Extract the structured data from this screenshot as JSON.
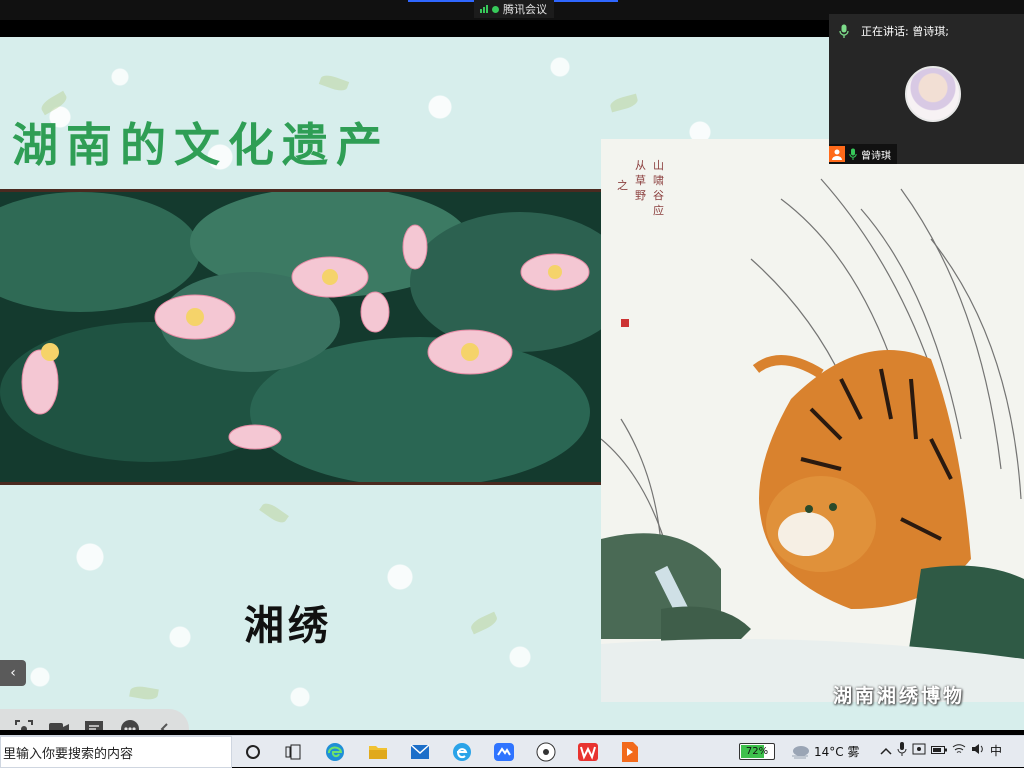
{
  "meeting": {
    "app_name": "腾讯会议",
    "speaking_label": "正在讲话: 曾诗琪;",
    "participant_name": "曾诗琪"
  },
  "slide": {
    "title": "湖南的文化遗产",
    "caption": "湘绣",
    "museum_watermark": "湖南湘绣博物"
  },
  "share_controls": {
    "icons": [
      "screenshot-icon",
      "camera-icon",
      "chat-icon",
      "more-icon",
      "collapse-icon"
    ]
  },
  "taskbar": {
    "search_placeholder": "里输入你要搜索的内容",
    "battery": "72%",
    "battery_level": 0.72,
    "weather": "14°C 雾",
    "ime": "中"
  },
  "colors": {
    "slide_bg": "#d7eeec",
    "title_green": "#2f9e55",
    "signal_green": "#37c95a",
    "participant_orange": "#ff6a1a"
  }
}
